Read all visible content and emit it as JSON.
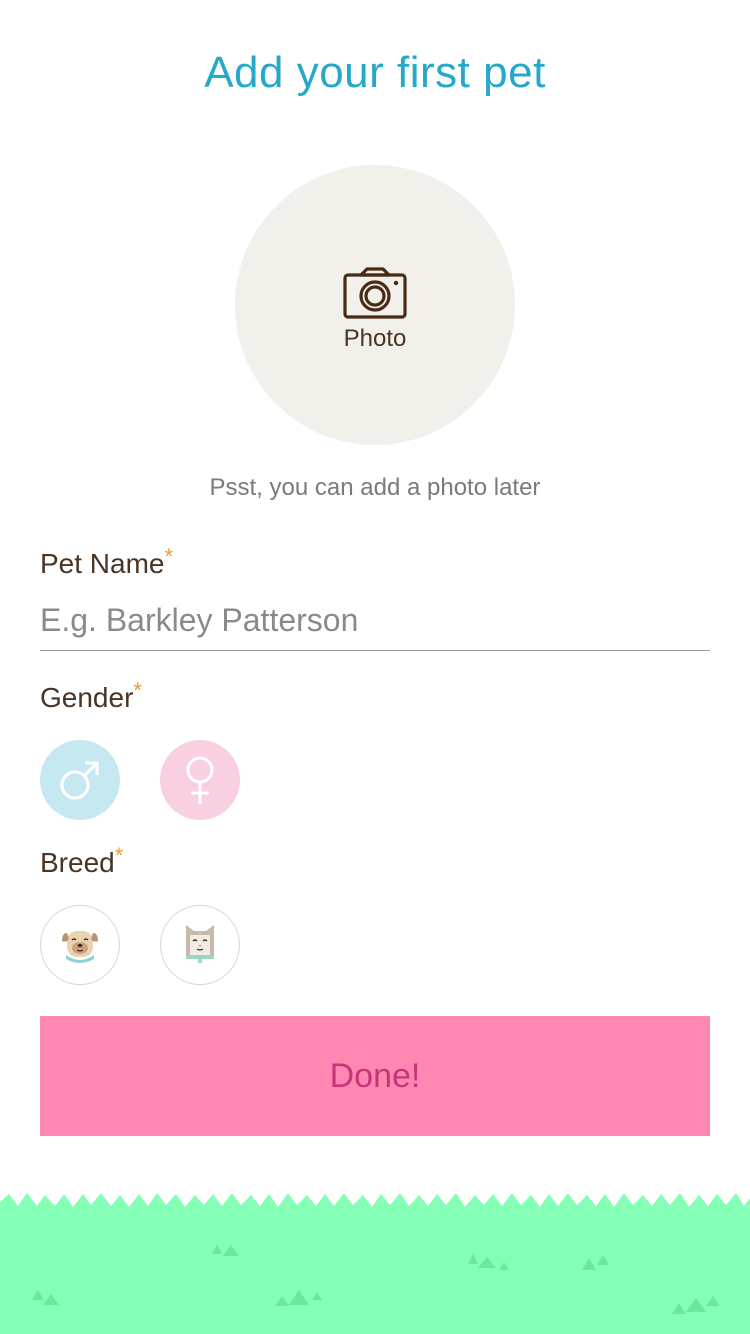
{
  "header": {
    "title": "Add your first pet"
  },
  "photo": {
    "label": "Photo",
    "icon": "camera-icon",
    "hint": "Psst, you can add a photo later"
  },
  "form": {
    "pet_name": {
      "label": "Pet Name",
      "required_mark": "*",
      "placeholder": "E.g. Barkley Patterson",
      "value": ""
    },
    "gender": {
      "label": "Gender",
      "required_mark": "*",
      "options": [
        {
          "icon": "male-symbol-icon",
          "color": "#c6e9f1"
        },
        {
          "icon": "female-symbol-icon",
          "color": "#f9d0e1"
        }
      ]
    },
    "breed": {
      "label": "Breed",
      "required_mark": "*",
      "options": [
        {
          "icon": "dog-icon"
        },
        {
          "icon": "cat-icon"
        }
      ]
    }
  },
  "actions": {
    "done_label": "Done!"
  },
  "colors": {
    "title": "#26a9c9",
    "required": "#f39c2a",
    "done_button": "#ff87b1",
    "done_text": "#c6357a",
    "grass": "#86ffb6",
    "grass_tufts": "#6be89b"
  }
}
